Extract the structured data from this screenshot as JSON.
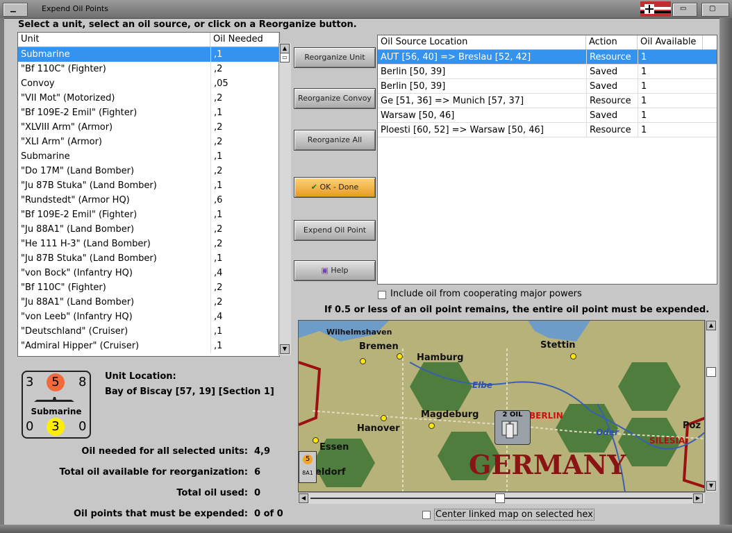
{
  "window": {
    "title": "Expend Oil Points"
  },
  "instruction": "Select a unit, select an oil source, or click on a Reorganize button.",
  "units_table": {
    "headers": [
      "Unit",
      "Oil Needed"
    ],
    "rows": [
      [
        "Submarine",
        ",1"
      ],
      [
        "\"Bf 110C\" (Fighter)",
        ",2"
      ],
      [
        "Convoy",
        ",05"
      ],
      [
        "\"VII Mot\" (Motorized)",
        ",2"
      ],
      [
        "\"Bf 109E-2 Emil\" (Fighter)",
        ",1"
      ],
      [
        "\"XLVIII Arm\" (Armor)",
        ",2"
      ],
      [
        "\"XLI Arm\" (Armor)",
        ",2"
      ],
      [
        "Submarine",
        ",1"
      ],
      [
        "\"Do 17M\" (Land Bomber)",
        ",2"
      ],
      [
        "\"Ju 87B Stuka\" (Land Bomber)",
        ",1"
      ],
      [
        "\"Rundstedt\" (Armor HQ)",
        ",6"
      ],
      [
        "\"Bf 109E-2 Emil\" (Fighter)",
        ",1"
      ],
      [
        "\"Ju 88A1\" (Land Bomber)",
        ",2"
      ],
      [
        "\"He 111 H-3\" (Land Bomber)",
        ",2"
      ],
      [
        "\"Ju 87B Stuka\" (Land Bomber)",
        ",1"
      ],
      [
        "\"von Bock\" (Infantry HQ)",
        ",4"
      ],
      [
        "\"Bf 110C\" (Fighter)",
        ",2"
      ],
      [
        "\"Ju 88A1\" (Land Bomber)",
        ",2"
      ],
      [
        "\"von Leeb\" (Infantry HQ)",
        ",4"
      ],
      [
        "\"Deutschland\" (Cruiser)",
        ",1"
      ],
      [
        "\"Admiral Hipper\" (Cruiser)",
        ",1"
      ]
    ]
  },
  "buttons": {
    "reorganize_unit": "Reorganize Unit",
    "reorganize_convoy": "Reorganize Convoy",
    "reorganize_all": "Reorganize All",
    "ok_done": "OK - Done",
    "expend_oil_point": "Expend Oil Point",
    "help": "Help"
  },
  "oil_table": {
    "headers": [
      "Oil Source Location",
      "Action",
      "Oil Available"
    ],
    "rows": [
      [
        "AUT [56, 40] => Breslau [52, 42]",
        "Resource",
        "1"
      ],
      [
        "Berlin [50, 39]",
        "Saved",
        "1"
      ],
      [
        "Berlin [50, 39]",
        "Saved",
        "1"
      ],
      [
        "Ge [51, 36] => Munich [57, 37]",
        "Resource",
        "1"
      ],
      [
        "Warsaw [50, 46]",
        "Saved",
        "1"
      ],
      [
        "Ploesti [60, 52] => Warsaw [50, 46]",
        "Resource",
        "1"
      ]
    ]
  },
  "include_oil_label": "Include oil from cooperating major powers",
  "half_point_note": "If 0.5 or less of an oil point remains, the entire oil point must be expended.",
  "unit_card": {
    "top_left": "3",
    "top_mid": "5",
    "top_right": "8",
    "name": "Submarine",
    "bottom_left": "0",
    "bottom_mid": "3",
    "bottom_right": "0",
    "colors": {
      "top_mid": "#f26a3c",
      "bottom_mid": "#ffee00"
    }
  },
  "unit_location": {
    "label": "Unit Location:",
    "value": "Bay of Biscay [57, 19] [Section 1]"
  },
  "stats": {
    "oil_needed_label": "Oil needed for all selected units:",
    "oil_needed_value": "4,9",
    "total_available_label": "Total oil available for reorganization:",
    "total_available_value": "6",
    "total_used_label": "Total oil used:",
    "total_used_value": "0",
    "must_expend_label": "Oil points that must be expended:",
    "must_expend_value": "0 of 0"
  },
  "map": {
    "labels": {
      "wilhelmshaven": "Wilhelmshaven",
      "bremen": "Bremen",
      "hamburg": "Hamburg",
      "stettin": "Stettin",
      "elbe": "Elbe",
      "magdeburg": "Magdeburg",
      "hanover": "Hanover",
      "berlin": "BERLIN",
      "oder": "Oder",
      "essen": "Essen",
      "dusseldorf": "eldorf",
      "germany": "GERMANY",
      "silesia": "SILESIA",
      "poz": "Poz",
      "oil_badge": "2 OIL",
      "unit_num": "5",
      "unit_tag": "8A1"
    }
  },
  "center_map_label": "Center linked map on selected hex"
}
